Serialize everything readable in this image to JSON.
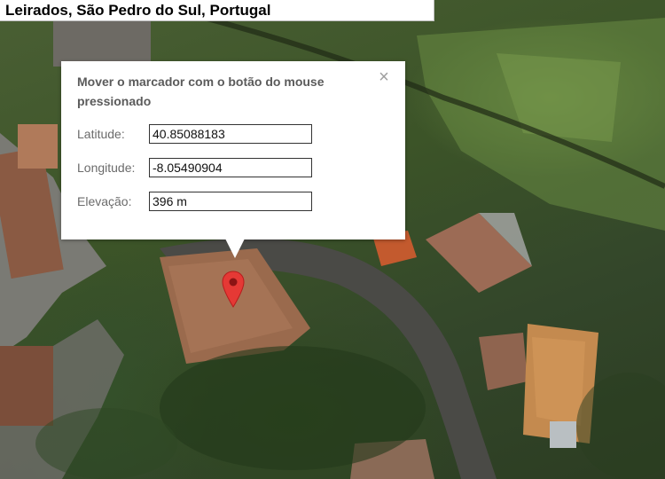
{
  "map": {
    "place_title": "Leirados, São Pedro do Sul, Portugal",
    "marker": {
      "icon": "map-pin-icon",
      "color": "#e53935"
    }
  },
  "info_window": {
    "heading": "Mover o marcador com o botão do mouse pressionado",
    "close_icon": "×",
    "fields": {
      "latitude": {
        "label": "Latitude:",
        "value": "40.85088183"
      },
      "longitude": {
        "label": "Longitude:",
        "value": "-8.05490904"
      },
      "elevation": {
        "label": "Elevação:",
        "value": "396 m"
      }
    }
  }
}
